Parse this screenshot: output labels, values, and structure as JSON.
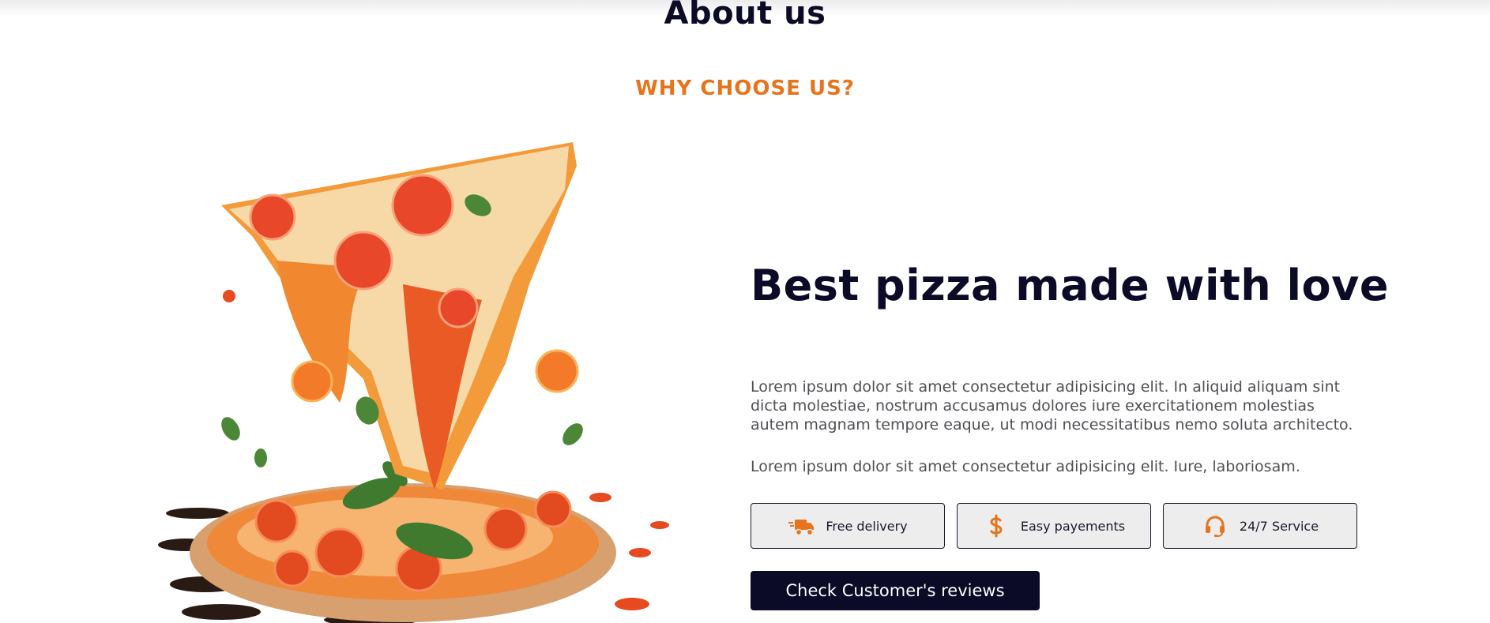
{
  "section": {
    "title": "About us",
    "subtitle": "WHY CHOOSE US?"
  },
  "about": {
    "headline": "Best pizza made with love",
    "paragraph_1": "Lorem ipsum dolor sit amet consectetur adipisicing elit. In aliquid aliquam sint dicta molestiae, nostrum accusamus dolores iure exercitationem molestias autem magnam tempore eaque, ut modi necessitatibus nemo soluta architecto.",
    "paragraph_2": "Lorem ipsum dolor sit amet consectetur adipisicing elit. Iure, laboriosam."
  },
  "features": [
    {
      "label": "Free delivery",
      "icon": "delivery-truck-icon"
    },
    {
      "label": "Easy payements",
      "icon": "dollar-icon"
    },
    {
      "label": "24/7 Service",
      "icon": "headset-icon"
    }
  ],
  "cta": {
    "label": "Check Customer's reviews"
  },
  "colors": {
    "accent": "#e8731d",
    "dark": "#0b0a27",
    "button_bg": "#ededed"
  }
}
